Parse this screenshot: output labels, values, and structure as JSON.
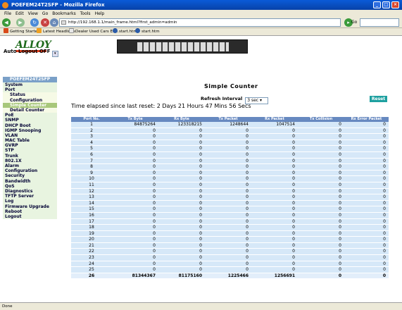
{
  "window": {
    "title": "POEFEM24T2SFP - Mozilla Firefox",
    "min": "_",
    "max": "□",
    "close": "×"
  },
  "menu": [
    "File",
    "Edit",
    "View",
    "Go",
    "Bookmarks",
    "Tools",
    "Help"
  ],
  "toolbar": {
    "url": "http://192.168.1.1/main_frame.html?first_admin=admin",
    "go": "Go"
  },
  "bookmarks": [
    "Getting Started",
    "Latest Headlines",
    "Dealer Used Cars En...",
    "start.htm",
    "start.htm"
  ],
  "header": {
    "logo": "ALLOY",
    "auto_logout_label": "Auto Logout OFF"
  },
  "sidebar": {
    "title": "POEFEM24T2SFP",
    "items": [
      {
        "label": "System",
        "sub": false,
        "active": false
      },
      {
        "label": "Port",
        "sub": false,
        "active": false
      },
      {
        "label": "Status",
        "sub": true,
        "active": false
      },
      {
        "label": "Configuration",
        "sub": true,
        "active": false
      },
      {
        "label": "Simple Counter",
        "sub": true,
        "active": true
      },
      {
        "label": "Detail Counter",
        "sub": true,
        "active": false
      },
      {
        "label": "PoE",
        "sub": false,
        "active": false
      },
      {
        "label": "SNMP",
        "sub": false,
        "active": false
      },
      {
        "label": "DHCP Boot",
        "sub": false,
        "active": false
      },
      {
        "label": "IGMP Snooping",
        "sub": false,
        "active": false
      },
      {
        "label": "VLAN",
        "sub": false,
        "active": false
      },
      {
        "label": "MAC Table",
        "sub": false,
        "active": false
      },
      {
        "label": "GVRP",
        "sub": false,
        "active": false
      },
      {
        "label": "STP",
        "sub": false,
        "active": false
      },
      {
        "label": "Trunk",
        "sub": false,
        "active": false
      },
      {
        "label": "802.1X",
        "sub": false,
        "active": false
      },
      {
        "label": "Alarm",
        "sub": false,
        "active": false
      },
      {
        "label": "Configuration",
        "sub": false,
        "active": false
      },
      {
        "label": "Security",
        "sub": false,
        "active": false
      },
      {
        "label": "Bandwidth",
        "sub": false,
        "active": false
      },
      {
        "label": "QoS",
        "sub": false,
        "active": false
      },
      {
        "label": "Diagnostics",
        "sub": false,
        "active": false
      },
      {
        "label": "TFTP Server",
        "sub": false,
        "active": false
      },
      {
        "label": "Log",
        "sub": false,
        "active": false
      },
      {
        "label": "Firmware Upgrade",
        "sub": false,
        "active": false
      },
      {
        "label": "Reboot",
        "sub": false,
        "active": false
      },
      {
        "label": "Logout",
        "sub": false,
        "active": false
      }
    ]
  },
  "main": {
    "title": "Simple Counter",
    "refresh_label": "Refresh Interval",
    "refresh_value": "3 sec",
    "reset_label": "Reset",
    "elapsed": "Time elapsed since last reset: 2 Days 21 Hours 47 Mins 56 Secs",
    "columns": [
      "Port No.",
      "Tx Byte",
      "Rx Byte",
      "Tx Packet",
      "Rx Packet",
      "Tx Collision",
      "Rx Error Packet"
    ],
    "rows": [
      [
        "1",
        "84875264",
        "123318215",
        "1248644",
        "1047514",
        "0",
        "0"
      ],
      [
        "2",
        "0",
        "0",
        "0",
        "0",
        "0",
        "0"
      ],
      [
        "3",
        "0",
        "0",
        "0",
        "0",
        "0",
        "0"
      ],
      [
        "4",
        "0",
        "0",
        "0",
        "0",
        "0",
        "0"
      ],
      [
        "5",
        "0",
        "0",
        "0",
        "0",
        "0",
        "0"
      ],
      [
        "6",
        "0",
        "0",
        "0",
        "0",
        "0",
        "0"
      ],
      [
        "7",
        "0",
        "0",
        "0",
        "0",
        "0",
        "0"
      ],
      [
        "8",
        "0",
        "0",
        "0",
        "0",
        "0",
        "0"
      ],
      [
        "9",
        "0",
        "0",
        "0",
        "0",
        "0",
        "0"
      ],
      [
        "10",
        "0",
        "0",
        "0",
        "0",
        "0",
        "0"
      ],
      [
        "11",
        "0",
        "0",
        "0",
        "0",
        "0",
        "0"
      ],
      [
        "12",
        "0",
        "0",
        "0",
        "0",
        "0",
        "0"
      ],
      [
        "13",
        "0",
        "0",
        "0",
        "0",
        "0",
        "0"
      ],
      [
        "14",
        "0",
        "0",
        "0",
        "0",
        "0",
        "0"
      ],
      [
        "15",
        "0",
        "0",
        "0",
        "0",
        "0",
        "0"
      ],
      [
        "16",
        "0",
        "0",
        "0",
        "0",
        "0",
        "0"
      ],
      [
        "17",
        "0",
        "0",
        "0",
        "0",
        "0",
        "0"
      ],
      [
        "18",
        "0",
        "0",
        "0",
        "0",
        "0",
        "0"
      ],
      [
        "19",
        "0",
        "0",
        "0",
        "0",
        "0",
        "0"
      ],
      [
        "20",
        "0",
        "0",
        "0",
        "0",
        "0",
        "0"
      ],
      [
        "21",
        "0",
        "0",
        "0",
        "0",
        "0",
        "0"
      ],
      [
        "22",
        "0",
        "0",
        "0",
        "0",
        "0",
        "0"
      ],
      [
        "23",
        "0",
        "0",
        "0",
        "0",
        "0",
        "0"
      ],
      [
        "24",
        "0",
        "0",
        "0",
        "0",
        "0",
        "0"
      ],
      [
        "25",
        "0",
        "0",
        "0",
        "0",
        "0",
        "0"
      ],
      [
        "26",
        "81344367",
        "81175160",
        "1225466",
        "1256691",
        "0",
        "0"
      ]
    ]
  },
  "status": {
    "text": "Done"
  }
}
